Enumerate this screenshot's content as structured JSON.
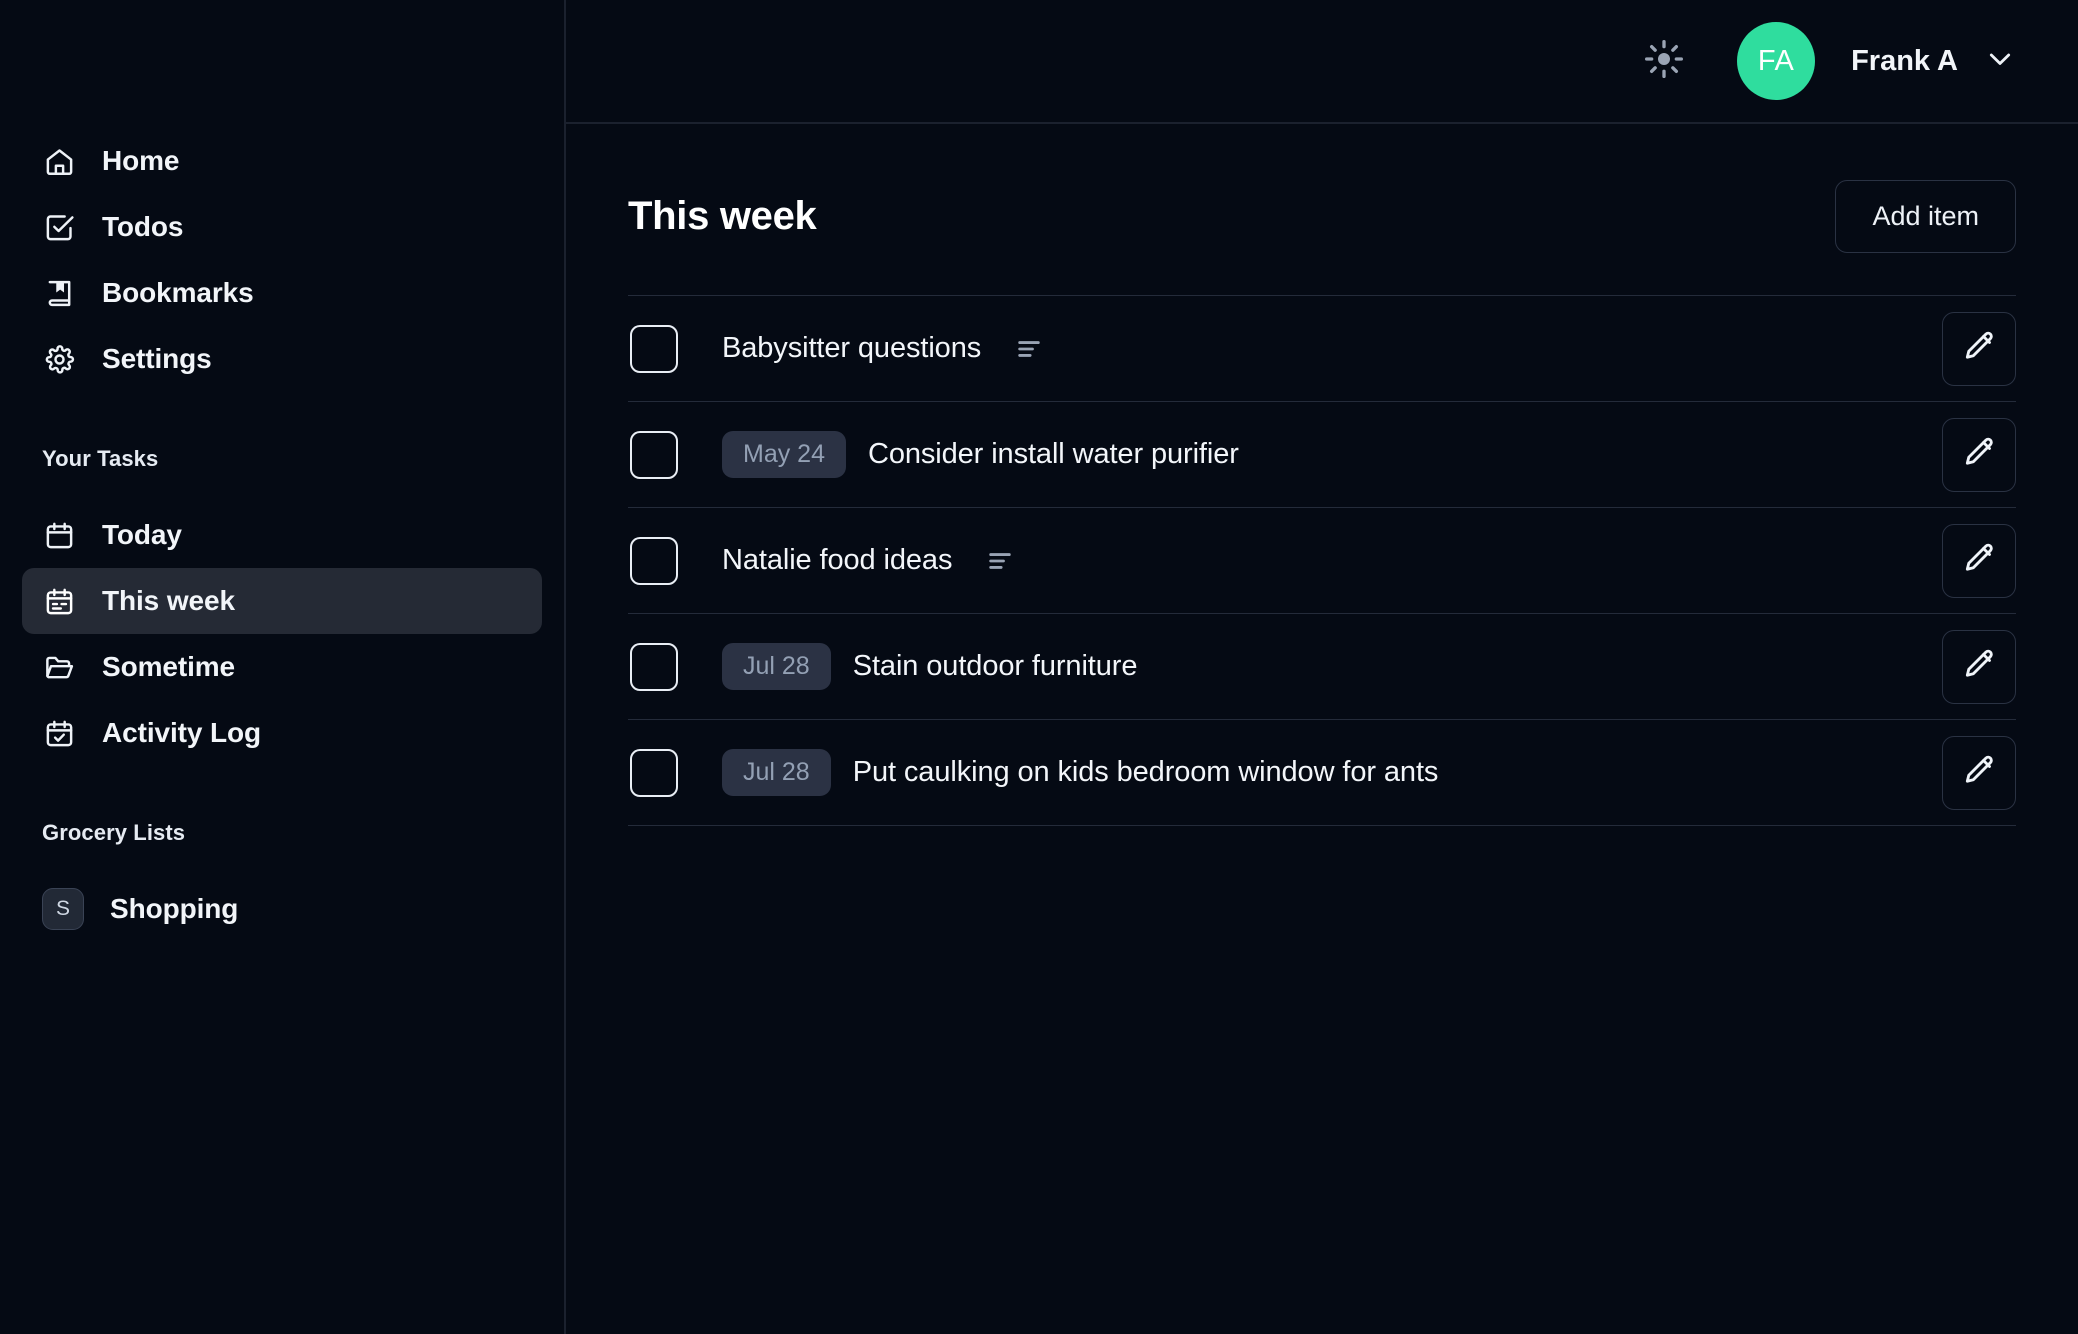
{
  "theme": {
    "background": "#050a14",
    "accent_green": "#2fdd9e",
    "active_item_bg": "#252a35",
    "pill_bg": "#2b3244",
    "pill_text": "#93a0b4",
    "border": "#242b3a"
  },
  "sidebar": {
    "primary_nav": [
      {
        "label": "Home",
        "icon": "home-icon",
        "active": false
      },
      {
        "label": "Todos",
        "icon": "check-square-icon",
        "active": false
      },
      {
        "label": "Bookmarks",
        "icon": "bookmark-icon",
        "active": false
      },
      {
        "label": "Settings",
        "icon": "gear-icon",
        "active": false
      }
    ],
    "tasks_section": {
      "title": "Your Tasks",
      "items": [
        {
          "label": "Today",
          "icon": "calendar-icon",
          "active": false
        },
        {
          "label": "This week",
          "icon": "calendar-week-icon",
          "active": true
        },
        {
          "label": "Sometime",
          "icon": "folder-open-icon",
          "active": false
        },
        {
          "label": "Activity Log",
          "icon": "calendar-check-icon",
          "active": false
        }
      ]
    },
    "grocery_section": {
      "title": "Grocery Lists",
      "items": [
        {
          "label": "Shopping",
          "badge": "S",
          "active": false
        }
      ]
    }
  },
  "topbar": {
    "theme_toggle_icon": "sun-icon",
    "avatar_initials": "FA",
    "user_name": "Frank A",
    "chevron_icon": "chevron-down-icon"
  },
  "main": {
    "page_title": "This week",
    "add_button_label": "Add item",
    "tasks": [
      {
        "title": "Babysitter questions",
        "date": "",
        "has_notes": true
      },
      {
        "title": "Consider install water purifier",
        "date": "May 24",
        "has_notes": false
      },
      {
        "title": "Natalie food ideas",
        "date": "",
        "has_notes": true
      },
      {
        "title": "Stain outdoor furniture",
        "date": "Jul 28",
        "has_notes": false
      },
      {
        "title": "Put caulking on kids bedroom window for ants",
        "date": "Jul 28",
        "has_notes": false
      }
    ],
    "edit_icon": "pencil-icon",
    "notes_icon": "notes-lines-icon",
    "checkbox_icon": "checkbox-unchecked-icon"
  }
}
